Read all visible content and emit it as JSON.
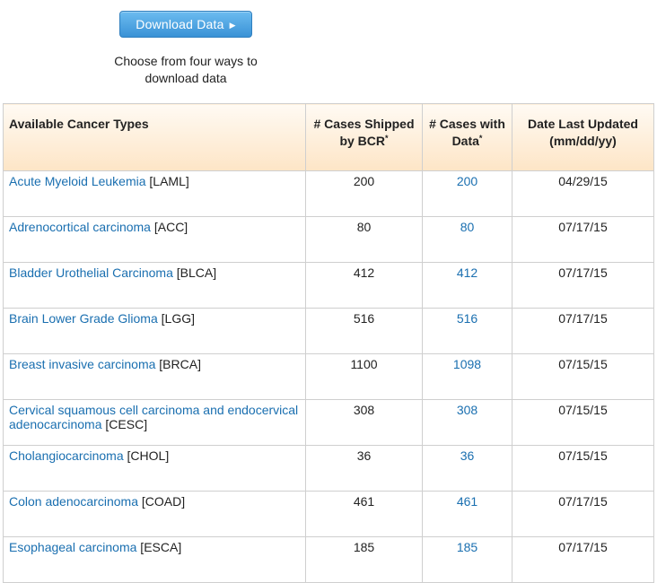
{
  "download": {
    "button_label": "Download Data",
    "caption_line1": "Choose from four ways to",
    "caption_line2": "download data"
  },
  "table": {
    "headers": {
      "type": "Available Cancer Types",
      "shipped_line1": "# Cases Shipped",
      "shipped_line2": "by BCR",
      "with_data_line1": "# Cases with",
      "with_data_line2": "Data",
      "asterisk": "*",
      "date_line1": "Date Last Updated",
      "date_line2": "(mm/dd/yy)"
    },
    "rows": [
      {
        "name": "Acute Myeloid Leukemia",
        "code": " [LAML]",
        "shipped": "200",
        "with_data": "200",
        "date": "04/29/15"
      },
      {
        "name": "Adrenocortical carcinoma",
        "code": " [ACC]",
        "shipped": "80",
        "with_data": "80",
        "date": "07/17/15"
      },
      {
        "name": "Bladder Urothelial Carcinoma",
        "code": " [BLCA]",
        "shipped": "412",
        "with_data": "412",
        "date": "07/17/15"
      },
      {
        "name": "Brain Lower Grade Glioma",
        "code": " [LGG]",
        "shipped": "516",
        "with_data": "516",
        "date": "07/17/15"
      },
      {
        "name": "Breast invasive carcinoma",
        "code": " [BRCA]",
        "shipped": "1100",
        "with_data": "1098",
        "date": "07/15/15"
      },
      {
        "name": "Cervical squamous cell carcinoma and endocervical adenocarcinoma",
        "code": " [CESC]",
        "shipped": "308",
        "with_data": "308",
        "date": "07/15/15"
      },
      {
        "name": "Cholangiocarcinoma",
        "code": " [CHOL]",
        "shipped": "36",
        "with_data": "36",
        "date": "07/15/15"
      },
      {
        "name": "Colon adenocarcinoma",
        "code": " [COAD]",
        "shipped": "461",
        "with_data": "461",
        "date": "07/17/15"
      },
      {
        "name": "Esophageal carcinoma",
        "code": " [ESCA]",
        "shipped": "185",
        "with_data": "185",
        "date": "07/17/15"
      }
    ]
  }
}
